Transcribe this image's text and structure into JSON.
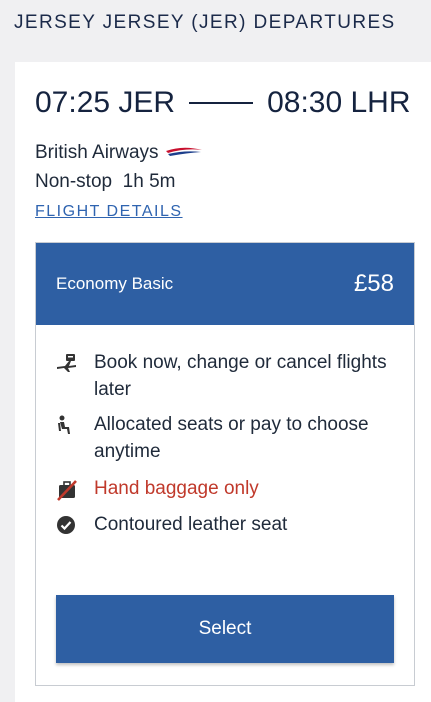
{
  "page": {
    "title": "JERSEY JERSEY (JER) DEPARTURES"
  },
  "flight": {
    "depart": "07:25 JER",
    "arrive": "08:30 LHR",
    "airline": "British Airways",
    "stops": "Non-stop",
    "duration": "1h 5m",
    "details_link": "FLIGHT DETAILS"
  },
  "fare": {
    "name": "Economy Basic",
    "price": "£58",
    "features": [
      {
        "icon": "flight-change-icon",
        "text": "Book now, change or cancel flights later"
      },
      {
        "icon": "seat-icon",
        "text": "Allocated seats or pay to choose anytime"
      },
      {
        "icon": "no-baggage-icon",
        "text": "Hand baggage only",
        "color": "#c0392b"
      },
      {
        "icon": "check-circle-icon",
        "text": "Contoured leather seat"
      }
    ],
    "select_label": "Select"
  },
  "colors": {
    "primary": "#2e5fa3",
    "warning": "#c0392b",
    "text": "#1a2740",
    "background": "#f0f0f2"
  }
}
